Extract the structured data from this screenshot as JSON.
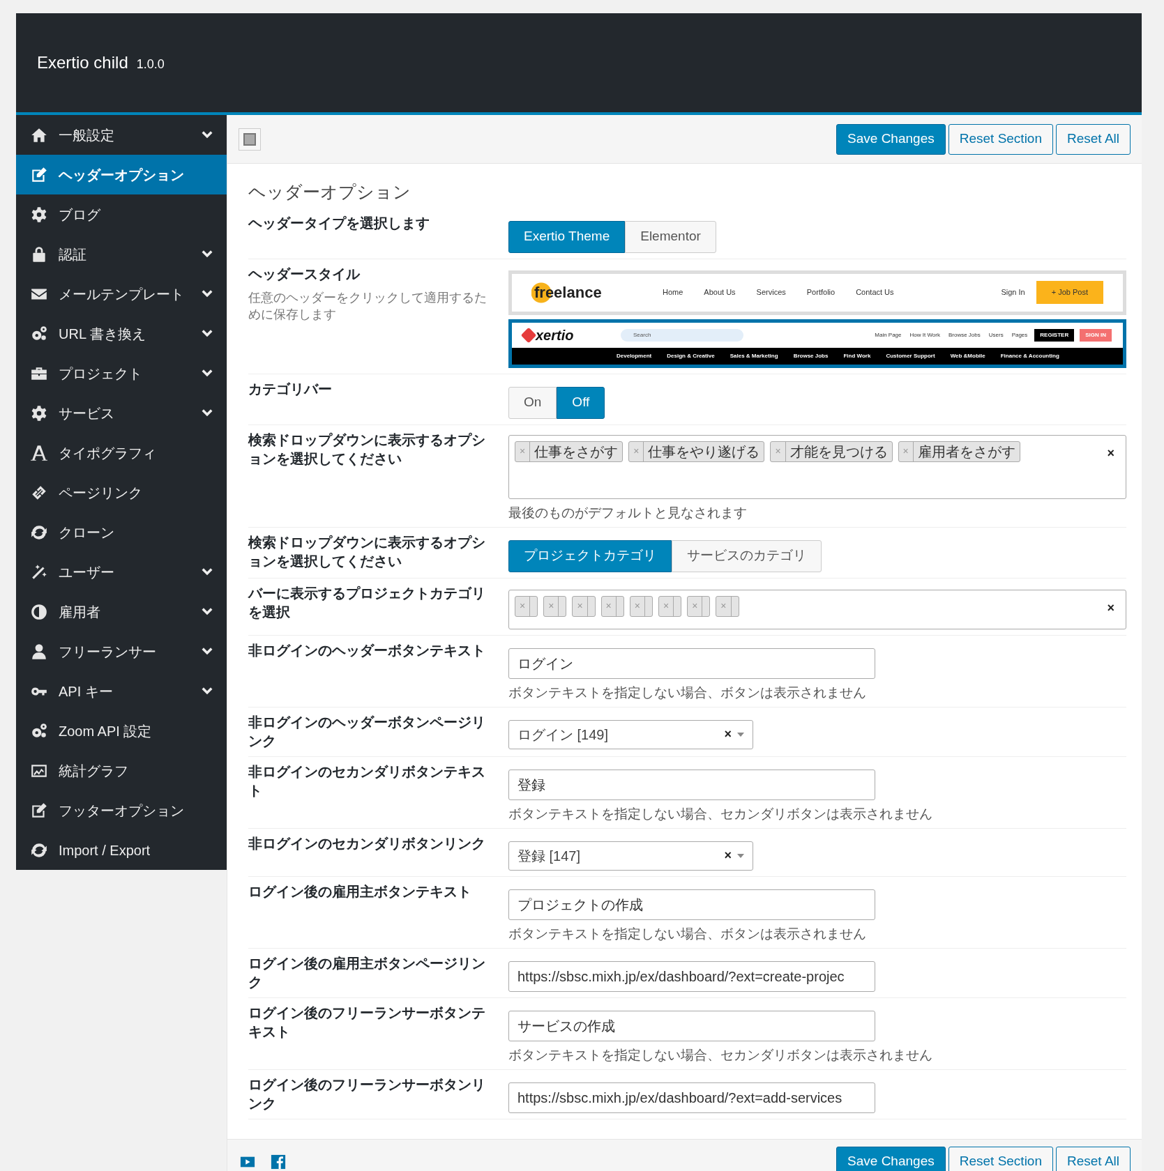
{
  "app": {
    "title": "Exertio child",
    "version": "1.0.0"
  },
  "sidebar": {
    "items": [
      {
        "kind": "home",
        "label": "一般設定",
        "has_submenu": true,
        "selected": false
      },
      {
        "kind": "edit",
        "label": "ヘッダーオプション",
        "has_submenu": false,
        "selected": true
      },
      {
        "kind": "gear",
        "label": "ブログ",
        "has_submenu": false,
        "selected": false
      },
      {
        "kind": "lock",
        "label": "認証",
        "has_submenu": true,
        "selected": false
      },
      {
        "kind": "envelope",
        "label": "メールテンプレート",
        "has_submenu": true,
        "selected": false
      },
      {
        "kind": "gears",
        "label": "URL 書き換え",
        "has_submenu": true,
        "selected": false
      },
      {
        "kind": "briefcase",
        "label": "プロジェクト",
        "has_submenu": true,
        "selected": false
      },
      {
        "kind": "gear",
        "label": "サービス",
        "has_submenu": true,
        "selected": false
      },
      {
        "kind": "font",
        "label": "タイポグラフィ",
        "has_submenu": false,
        "selected": false
      },
      {
        "kind": "link",
        "label": "ページリンク",
        "has_submenu": false,
        "selected": false
      },
      {
        "kind": "refresh",
        "label": "クローン",
        "has_submenu": false,
        "selected": false
      },
      {
        "kind": "magic",
        "label": "ユーザー",
        "has_submenu": true,
        "selected": false
      },
      {
        "kind": "contrast",
        "label": "雇用者",
        "has_submenu": true,
        "selected": false
      },
      {
        "kind": "user",
        "label": "フリーランサー",
        "has_submenu": true,
        "selected": false
      },
      {
        "kind": "key",
        "label": "API キー",
        "has_submenu": true,
        "selected": false
      },
      {
        "kind": "gears",
        "label": "Zoom API 設定",
        "has_submenu": false,
        "selected": false
      },
      {
        "kind": "chart",
        "label": "統計グラフ",
        "has_submenu": false,
        "selected": false
      },
      {
        "kind": "edit",
        "label": "フッターオプション",
        "has_submenu": false,
        "selected": false
      },
      {
        "kind": "refresh",
        "label": "Import / Export",
        "has_submenu": false,
        "selected": false
      }
    ]
  },
  "toolbar": {
    "buttons": [
      {
        "kind": "primary",
        "label": "Save Changes"
      },
      {
        "kind": "secondary",
        "label": "Reset Section"
      },
      {
        "kind": "secondary",
        "label": "Reset All"
      }
    ]
  },
  "section_title": "ヘッダーオプション",
  "fields": [
    {
      "kind": "buttonset",
      "label": "ヘッダータイプを選択します",
      "options": [
        {
          "label": "Exertio Theme",
          "selected": true
        },
        {
          "label": "Elementor",
          "selected": false
        }
      ]
    },
    {
      "kind": "image_select",
      "label": "ヘッダースタイル",
      "description": "任意のヘッダーをクリックして適用するために保存します",
      "options": [
        {
          "kind": "freelance",
          "logo": "freelance",
          "nav": [
            "Home",
            "About Us",
            "Services",
            "Portfolio",
            "Contact Us"
          ],
          "sign_in": "Sign In",
          "cta": "+ Job Post",
          "selected": false
        },
        {
          "kind": "exertio",
          "logo": "xertio",
          "search": "Search",
          "nav": [
            "Main Page",
            "How It Work",
            "Browse Jobs",
            "Users",
            "Pages"
          ],
          "register": "REGISTER",
          "sign_in": "SIGN IN",
          "categories": [
            "Development",
            "Design & Creative",
            "Sales & Marketing",
            "Browse Jobs",
            "Find Work",
            "Customer Support",
            "Web &Mobile",
            "Finance & Accounting"
          ],
          "selected": true
        }
      ]
    },
    {
      "kind": "buttonset",
      "label": "カテゴリバー",
      "options": [
        {
          "label": "On",
          "selected": false
        },
        {
          "label": "Off",
          "selected": true
        }
      ]
    },
    {
      "kind": "multiselect",
      "label": "検索ドロップダウンに表示するオプションを選択してください",
      "tags": [
        {
          "remove": "×",
          "label": "仕事をさがす"
        },
        {
          "remove": "×",
          "label": "仕事をやり遂げる"
        },
        {
          "remove": "×",
          "label": "才能を見つける"
        },
        {
          "remove": "×",
          "label": "雇用者をさがす"
        }
      ],
      "clear": "×",
      "description": "最後のものがデフォルトと見なされます"
    },
    {
      "kind": "buttonset",
      "label": "検索ドロップダウンに表示するオプションを選択してください",
      "options": [
        {
          "label": "プロジェクトカテゴリ",
          "selected": true
        },
        {
          "label": "サービスのカテゴリ",
          "selected": false
        }
      ]
    },
    {
      "kind": "multiselect",
      "label": "バーに表示するプロジェクトカテゴリを選択",
      "tags": [
        {
          "remove": "×"
        },
        {
          "remove": "×"
        },
        {
          "remove": "×"
        },
        {
          "remove": "×"
        },
        {
          "remove": "×"
        },
        {
          "remove": "×"
        },
        {
          "remove": "×"
        },
        {
          "remove": "×"
        }
      ],
      "clear": "×"
    },
    {
      "kind": "text",
      "label": "非ログインのヘッダーボタンテキスト",
      "value": "ログイン",
      "description": "ボタンテキストを指定しない場合、ボタンは表示されません"
    },
    {
      "kind": "select",
      "label": "非ログインのヘッダーボタンページリンク",
      "value": "ログイン [149]",
      "clear": "×"
    },
    {
      "kind": "text",
      "label": "非ログインのセカンダリボタンテキスト",
      "value": "登録",
      "description": "ボタンテキストを指定しない場合、セカンダリボタンは表示されません"
    },
    {
      "kind": "select",
      "label": "非ログインのセカンダリボタンリンク",
      "value": "登録 [147]",
      "clear": "×"
    },
    {
      "kind": "text",
      "label": "ログイン後の雇用主ボタンテキスト",
      "value": "プロジェクトの作成",
      "description": "ボタンテキストを指定しない場合、ボタンは表示されません"
    },
    {
      "kind": "text",
      "label": "ログイン後の雇用主ボタンページリンク",
      "value": "https://sbsc.mixh.jp/ex/dashboard/?ext=create-projec"
    },
    {
      "kind": "text",
      "label": "ログイン後のフリーランサーボタンテキスト",
      "value": "サービスの作成",
      "description": "ボタンテキストを指定しない場合、セカンダリボタンは表示されません"
    },
    {
      "kind": "text",
      "label": "ログイン後のフリーランサーボタンリンク",
      "value": "https://sbsc.mixh.jp/ex/dashboard/?ext=add-services"
    }
  ],
  "footer": {
    "social": [
      {
        "kind": "youtube"
      },
      {
        "kind": "facebook"
      }
    ],
    "buttons": [
      {
        "kind": "primary",
        "label": "Save Changes"
      },
      {
        "kind": "secondary",
        "label": "Reset Section"
      },
      {
        "kind": "secondary",
        "label": "Reset All"
      }
    ]
  }
}
